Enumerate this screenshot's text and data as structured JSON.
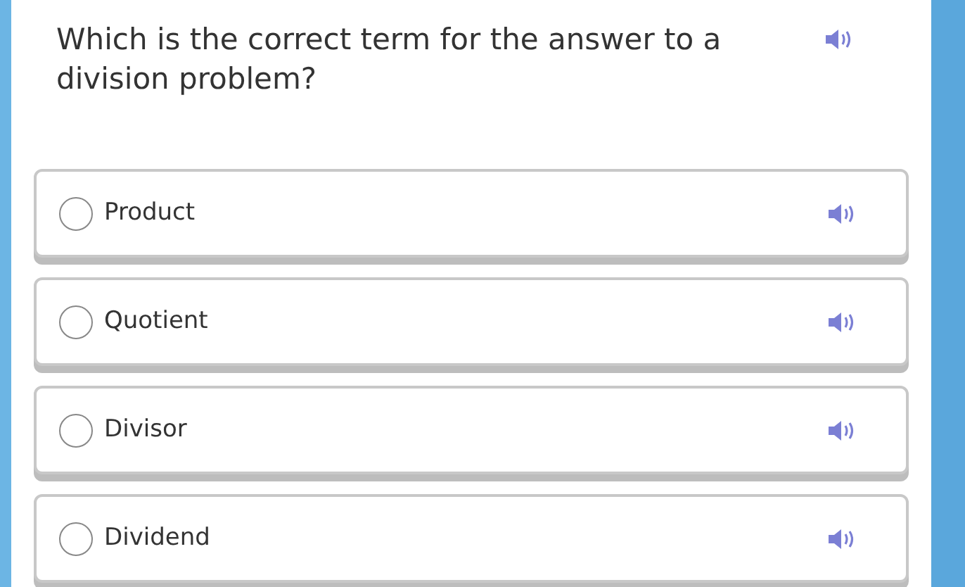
{
  "question": {
    "text": "Which is the correct term for the answer to a division problem?"
  },
  "options": [
    {
      "label": "Product",
      "selected": false
    },
    {
      "label": "Quotient",
      "selected": false
    },
    {
      "label": "Divisor",
      "selected": false
    },
    {
      "label": "Dividend",
      "selected": false
    }
  ]
}
